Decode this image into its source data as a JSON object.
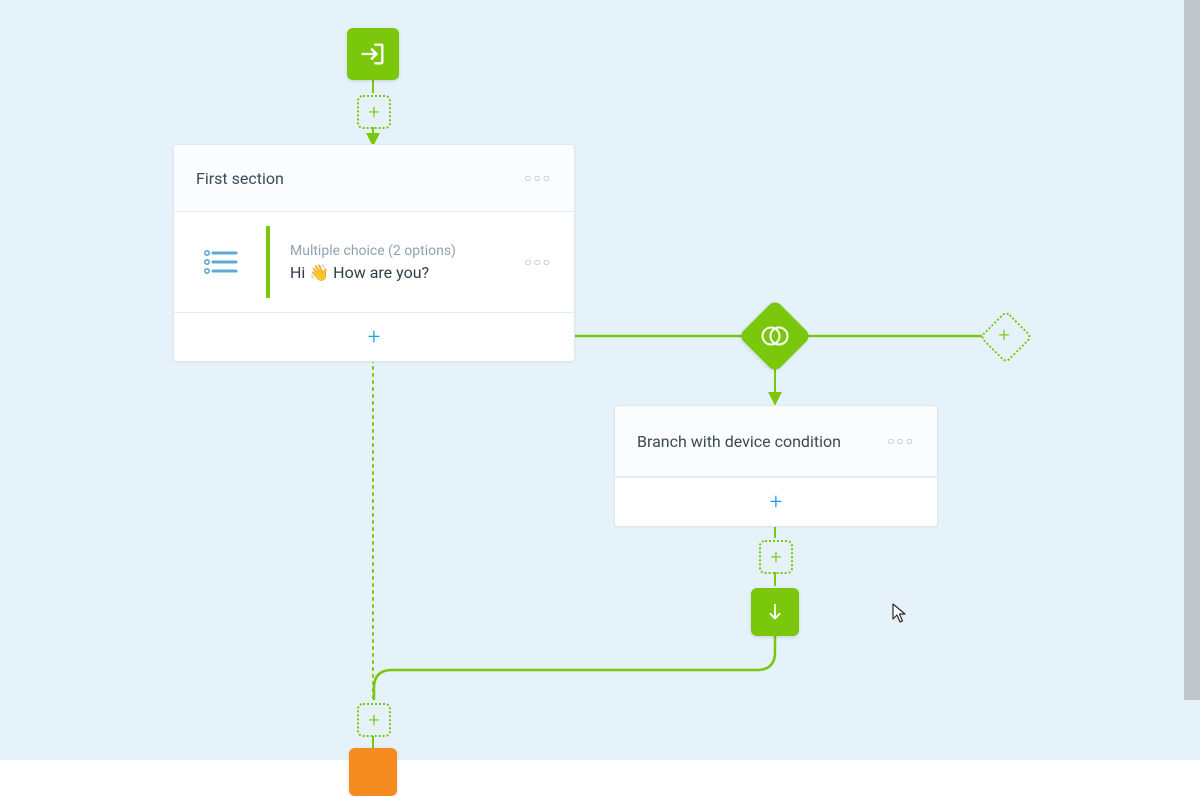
{
  "colors": {
    "accent_green": "#7ac70c",
    "accent_blue": "#1a9fe0",
    "accent_orange": "#f58b1f",
    "canvas_bg": "#e6f2fa"
  },
  "start_node": {
    "icon": "enter-arrow-icon"
  },
  "section_card": {
    "title": "First section",
    "question": {
      "type_label": "Multiple choice (2 options)",
      "text_prefix": "Hi ",
      "emoji": "👋",
      "text_suffix": " How are you?",
      "icon": "list-icon"
    }
  },
  "condition_node": {
    "icon": "venn-icon"
  },
  "branch_card": {
    "title": "Branch with device condition"
  },
  "end_node": {
    "icon": "arrow-down-icon"
  }
}
